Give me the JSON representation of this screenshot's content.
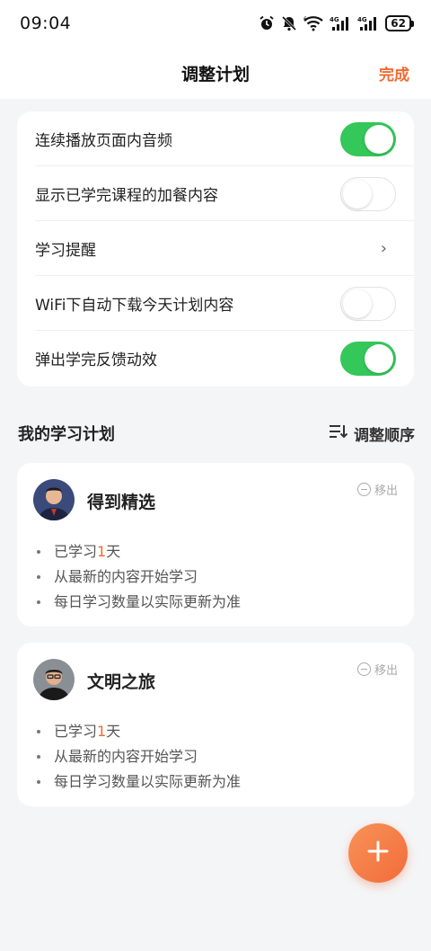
{
  "status_bar": {
    "time": "09:04",
    "battery": "62",
    "icons": [
      "alarm-icon",
      "mute-icon",
      "wifi-icon",
      "signal-4g-icon",
      "signal-4g-icon",
      "battery-icon"
    ]
  },
  "header": {
    "title": "调整计划",
    "done_label": "完成"
  },
  "settings": {
    "items": [
      {
        "label": "连续播放页面内音频",
        "control": "toggle",
        "on": true
      },
      {
        "label": "显示已学完课程的加餐内容",
        "control": "toggle",
        "on": false
      },
      {
        "label": "学习提醒",
        "control": "chevron",
        "icon": "›"
      },
      {
        "label": "WiFi下自动下载今天计划内容",
        "control": "toggle",
        "on": false
      },
      {
        "label": "弹出学完反馈动效",
        "control": "toggle",
        "on": true
      }
    ]
  },
  "plans_section": {
    "title": "我的学习计划",
    "reorder_label": "调整顺序"
  },
  "plans": [
    {
      "name": "得到精选",
      "remove_label": "移出",
      "learned_prefix": "已学习",
      "learned_days": "1",
      "learned_suffix": "天",
      "point2": "从最新的内容开始学习",
      "point3": "每日学习数量以实际更新为准"
    },
    {
      "name": "文明之旅",
      "remove_label": "移出",
      "learned_prefix": "已学习",
      "learned_days": "1",
      "learned_suffix": "天",
      "point2": "从最新的内容开始学习",
      "point3": "每日学习数量以实际更新为准"
    }
  ],
  "colors": {
    "accent": "#f06a30",
    "toggle_on": "#34c759",
    "background": "#f4f5f7"
  }
}
